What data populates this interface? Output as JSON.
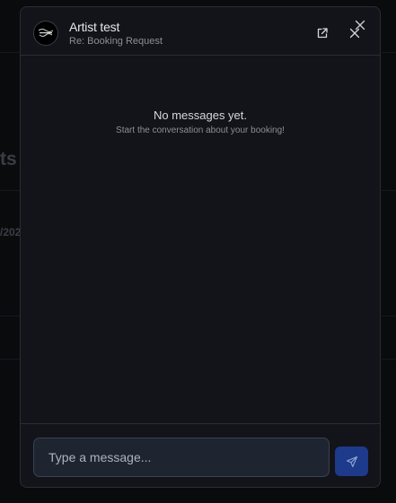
{
  "background": {
    "fragment_heading": "ts",
    "fragment_date": "/202"
  },
  "chat": {
    "artist_name": "Artist test",
    "subject": "Re: Booking Request",
    "avatar_icon": "artist-logo",
    "empty_title": "No messages yet.",
    "empty_subtitle": "Start the conversation about your booking!",
    "input_placeholder": "Type a message...",
    "input_value": ""
  },
  "icons": {
    "open_external": "external-link-icon",
    "close": "close-icon",
    "send": "send-icon"
  },
  "colors": {
    "modal_bg": "#121419",
    "border": "#2a2d34",
    "send_button": "#1e3a8a",
    "input_bg": "#1e2430"
  }
}
